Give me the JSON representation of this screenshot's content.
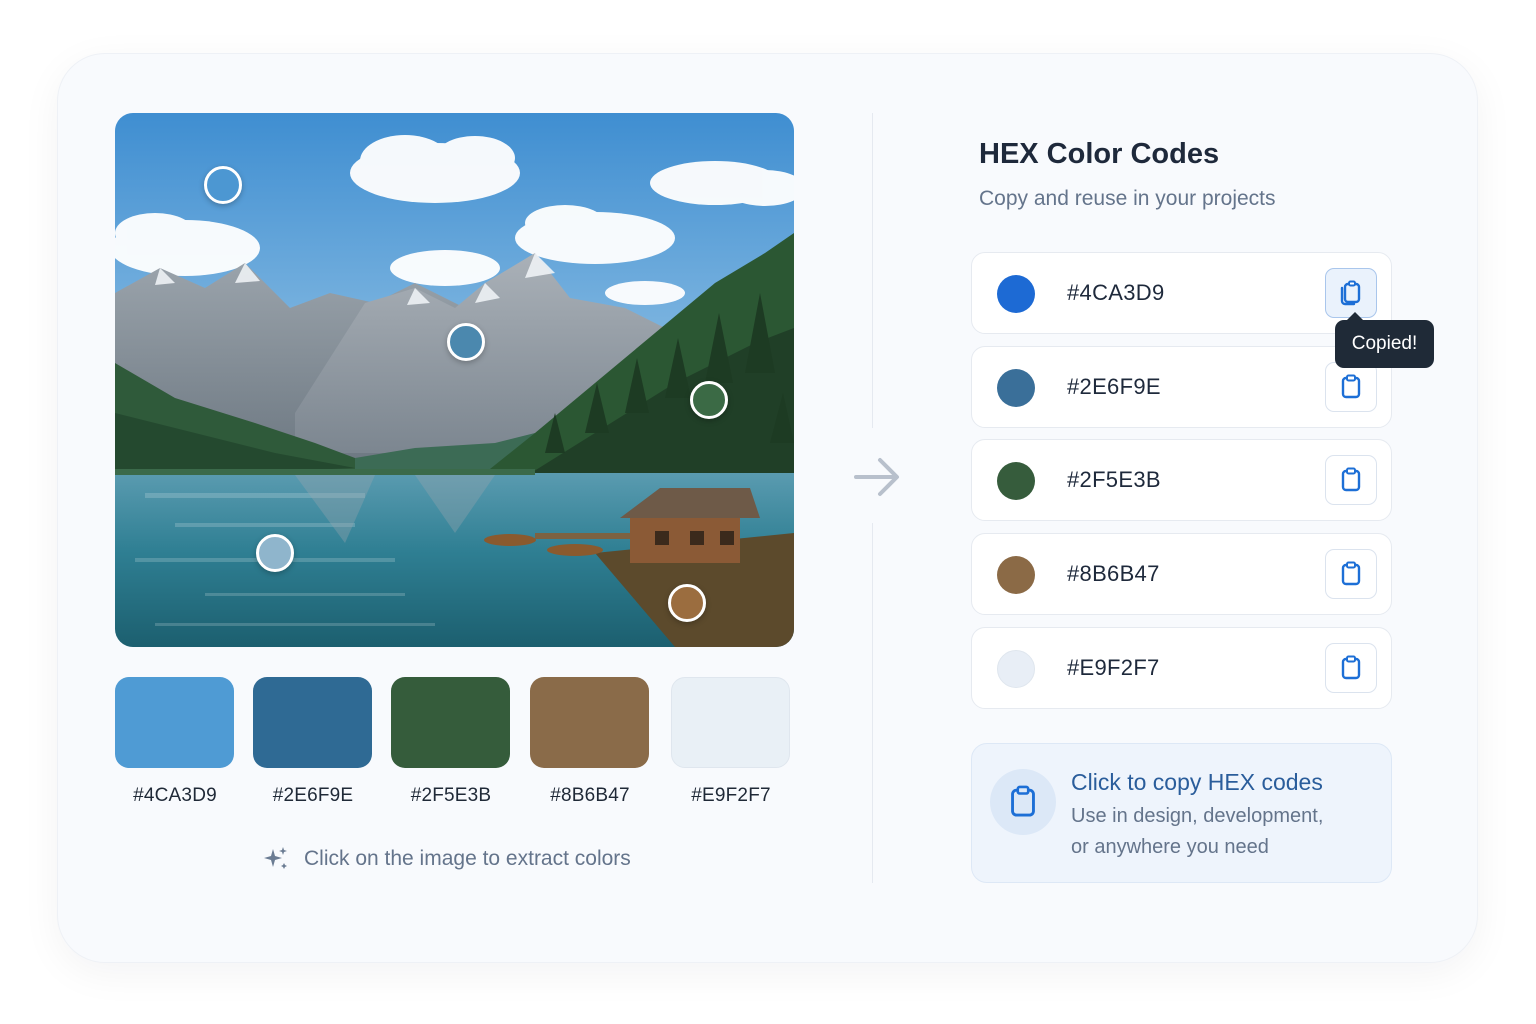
{
  "colors": {
    "accent": "#1d6fd6",
    "tooltip_bg": "#1f2a37",
    "info_bg": "#eef4fc"
  },
  "palette": [
    {
      "hex": "#4CA3D9",
      "swatch_color": "#4f9bd4",
      "dot_color": "#1d6ad4"
    },
    {
      "hex": "#2E6F9E",
      "swatch_color": "#2f6a94",
      "dot_color": "#3a6f99"
    },
    {
      "hex": "#2F5E3B",
      "swatch_color": "#355c3b",
      "dot_color": "#365c3c"
    },
    {
      "hex": "#8B6B47",
      "swatch_color": "#8a6b49",
      "dot_color": "#8b6a46"
    },
    {
      "hex": "#E9F2F7",
      "swatch_color": "#e9f0f6",
      "dot_color": "#e8eef6"
    }
  ],
  "picker_colors": [
    "#4c97d2",
    "#4b88ae",
    "#3b6a45",
    "#8fb5cc",
    "#9b6d3f"
  ],
  "hint": {
    "icon": "sparkle-icon",
    "text": "Click on the image to extract colors"
  },
  "panel": {
    "title": "HEX Color Codes",
    "subtitle": "Copy and reuse in your projects",
    "copy_icon": "copy-icon",
    "tooltip": "Copied!",
    "copied_index": 0
  },
  "info": {
    "icon": "copy-icon",
    "title": "Click to copy HEX codes",
    "line1": "Use in design, development,",
    "line2": "or anywhere you need"
  }
}
